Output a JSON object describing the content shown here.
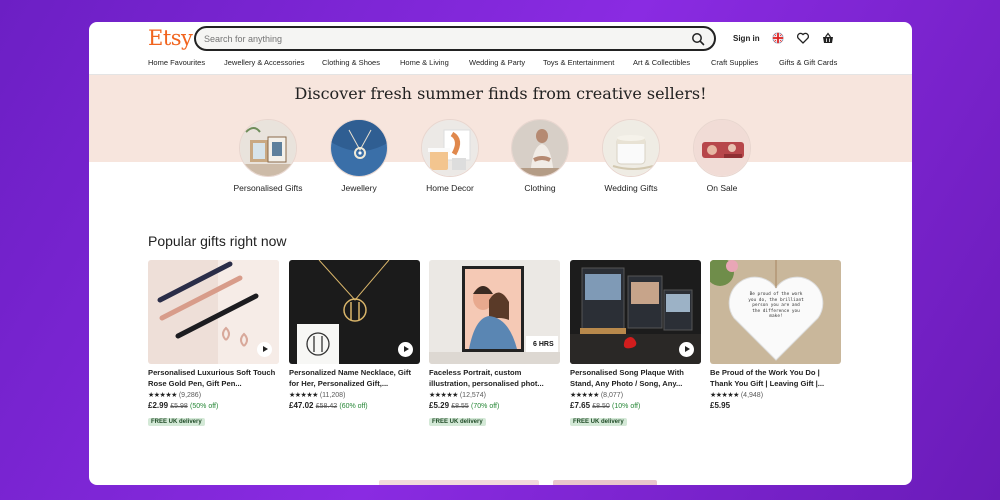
{
  "header": {
    "logo": "Etsy",
    "search_placeholder": "Search for anything",
    "signin_label": "Sign in",
    "icons": [
      "search-icon",
      "flag-icon",
      "heart-icon",
      "basket-icon"
    ]
  },
  "nav": {
    "items": [
      "Home Favourites",
      "Jewellery & Accessories",
      "Clothing & Shoes",
      "Home & Living",
      "Wedding & Party",
      "Toys & Entertainment",
      "Art & Collectibles",
      "Craft Supplies",
      "Gifts & Gift Cards"
    ]
  },
  "hero": {
    "title": "Discover fresh summer finds from creative sellers!",
    "categories": [
      {
        "label": "Personalised Gifts"
      },
      {
        "label": "Jewellery"
      },
      {
        "label": "Home Decor"
      },
      {
        "label": "Clothing"
      },
      {
        "label": "Wedding Gifts"
      },
      {
        "label": "On Sale"
      }
    ]
  },
  "popular": {
    "title": "Popular gifts right now",
    "products": [
      {
        "title": "Personalised Luxurious Soft Touch Rose Gold Pen, Gift Pen...",
        "stars": "★★★★★",
        "reviews": "(9,286)",
        "price": "£2.99",
        "original": "£5.98",
        "discount": "(50% off)",
        "badge": "FREE UK delivery"
      },
      {
        "title": "Personalized Name Necklace, Gift for Her, Personalized Gift,...",
        "stars": "★★★★★",
        "reviews": "(11,208)",
        "price": "£47.02",
        "original": "£58.42",
        "discount": "(60% off)",
        "badge": ""
      },
      {
        "title": "Faceless Portrait, custom illustration, personalised phot...",
        "stars": "★★★★★",
        "reviews": "(12,574)",
        "price": "£5.29",
        "original": "£8.55",
        "discount": "(70% off)",
        "badge": "FREE UK delivery"
      },
      {
        "title": "Personalised Song Plaque With Stand, Any Photo / Song, Any...",
        "stars": "★★★★★",
        "reviews": "(8,077)",
        "price": "£7.65",
        "original": "£8.50",
        "discount": "(10% off)",
        "badge": "FREE UK delivery"
      },
      {
        "title": "Be Proud of the Work You Do | Thank You Gift | Leaving Gift |...",
        "stars": "★★★★★",
        "reviews": "(4,948)",
        "price": "£5.95",
        "original": "",
        "discount": "",
        "badge": ""
      }
    ],
    "thumb_texts": {
      "hours": "6 HRS",
      "heart_note": "Be proud of the work you do, the brilliant person you are and the difference you make!"
    }
  },
  "colors": {
    "brand": "#f1641e",
    "hero_bg": "#f7e5dd",
    "discount": "#258635",
    "badge_bg": "#d4e9d7",
    "background": "#7b22d6"
  }
}
